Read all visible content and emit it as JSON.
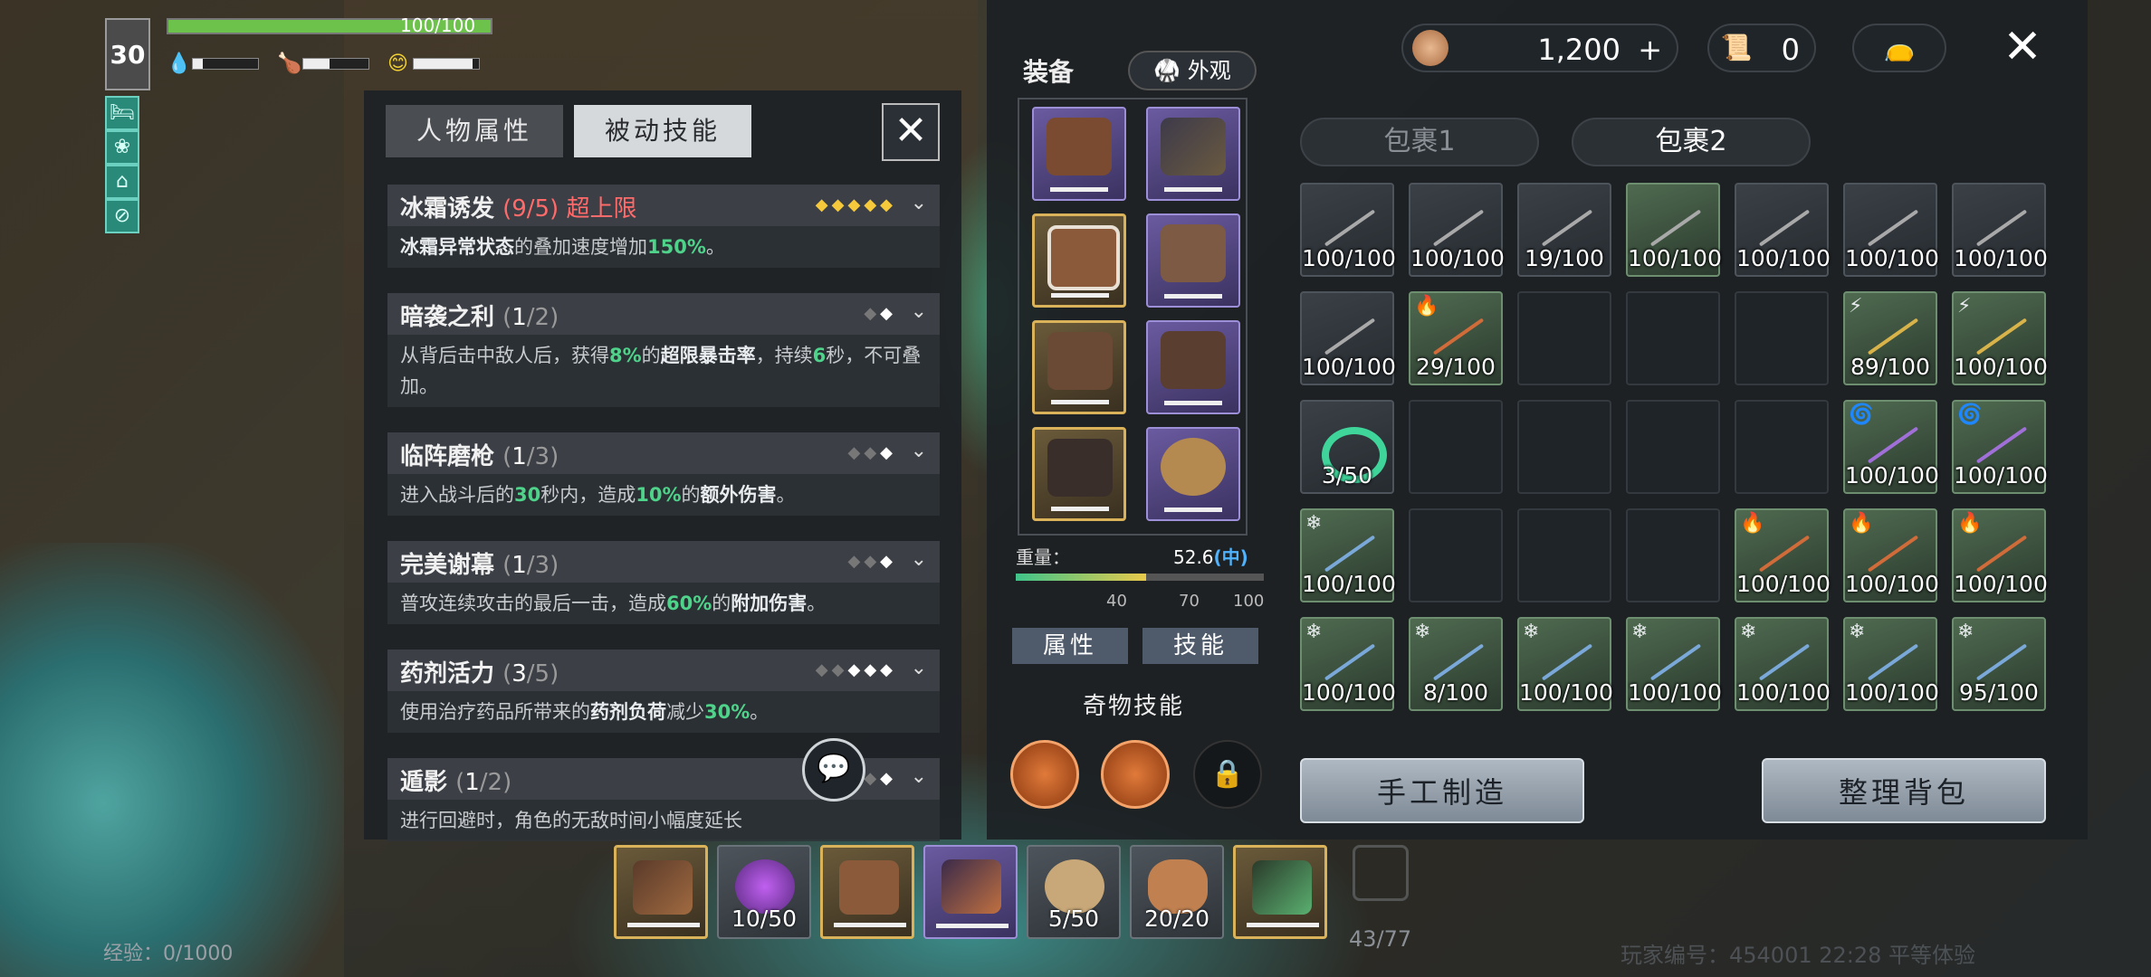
{
  "hud": {
    "level": "30",
    "hp_text": "100/100",
    "hp_fraction": 1.0,
    "water_fraction": 0.15,
    "food_fraction": 0.4,
    "mood_fraction": 0.9,
    "buff_icons": [
      "bed-icon",
      "stamina-icon",
      "house-icon",
      "no-bow-icon"
    ],
    "experience": "经验：0/1000"
  },
  "skills_panel": {
    "tabs": [
      "人物属性",
      "被动技能"
    ],
    "active_tab": 1,
    "skills": [
      {
        "name": "冰霜诱发",
        "level": "(9/5)",
        "extra": "超上限",
        "max": true,
        "desc_parts": [
          [
            "b",
            "冰霜异常状态"
          ],
          [
            "t",
            "的叠加速度增加"
          ],
          [
            "e",
            "150%"
          ],
          [
            "t",
            "。"
          ]
        ]
      },
      {
        "name": "暗袭之利",
        "level_cur": "1",
        "level_max": "/2",
        "desc_parts": [
          [
            "t",
            "从背后击中敌人后，获得"
          ],
          [
            "e",
            "8%"
          ],
          [
            "t",
            "的"
          ],
          [
            "b",
            "超限暴击率"
          ],
          [
            "t",
            "，持续"
          ],
          [
            "e",
            "6"
          ],
          [
            "t",
            "秒，不可叠加。"
          ]
        ]
      },
      {
        "name": "临阵磨枪",
        "level_cur": "1",
        "level_max": "/3",
        "desc_parts": [
          [
            "t",
            "进入战斗后的"
          ],
          [
            "e",
            "30"
          ],
          [
            "t",
            "秒内，造成"
          ],
          [
            "e",
            "10%"
          ],
          [
            "t",
            "的"
          ],
          [
            "b",
            "额外伤害"
          ],
          [
            "t",
            "。"
          ]
        ]
      },
      {
        "name": "完美谢幕",
        "level_cur": "1",
        "level_max": "/3",
        "desc_parts": [
          [
            "t",
            "普攻连续攻击的最后一击，造成"
          ],
          [
            "e",
            "60%"
          ],
          [
            "t",
            "的"
          ],
          [
            "b",
            "附加伤害"
          ],
          [
            "t",
            "。"
          ]
        ]
      },
      {
        "name": "药剂活力",
        "level_cur": "3",
        "level_max": "/5",
        "desc_parts": [
          [
            "t",
            "使用治疗药品所带来的"
          ],
          [
            "b",
            "药剂负荷"
          ],
          [
            "t",
            "减少"
          ],
          [
            "e",
            "30%"
          ],
          [
            "t",
            "。"
          ]
        ]
      },
      {
        "name": "遁影",
        "level_cur": "1",
        "level_max": "/2",
        "desc_parts": [
          [
            "t",
            "进行回避时，角色的无敌时间小幅度延长"
          ]
        ]
      }
    ]
  },
  "equipment": {
    "title": "装备",
    "appearance_label": "外观",
    "weight_label": "重量：",
    "weight_value": "52.6",
    "weight_class": "(中)",
    "weight_ticks": [
      "40",
      "70",
      "100"
    ],
    "attr_button": "属性",
    "skill_button": "技能",
    "oddity_title": "奇物技能"
  },
  "currency": {
    "coins": "1,200",
    "plus": "+",
    "scrolls": "0"
  },
  "bag": {
    "tabs": [
      "包裹1",
      "包裹2"
    ],
    "active_tab": 1,
    "rows": [
      [
        {
          "c": "100/100",
          "t": "spear",
          "g": 0
        },
        {
          "c": "100/100",
          "t": "spear",
          "g": 0
        },
        {
          "c": "19/100",
          "t": "spear",
          "g": 0
        },
        {
          "c": "100/100",
          "t": "spear",
          "g": 1
        },
        {
          "c": "100/100",
          "t": "spear",
          "g": 0
        },
        {
          "c": "100/100",
          "t": "spear",
          "g": 0
        },
        {
          "c": "100/100",
          "t": "spear",
          "g": 0
        }
      ],
      [
        {
          "c": "100/100",
          "t": "spear",
          "g": 0
        },
        {
          "c": "29/100",
          "t": "red",
          "g": 1,
          "b": "🔥"
        },
        {
          "c": "",
          "t": "empty"
        },
        {
          "c": "",
          "t": "empty"
        },
        {
          "c": "",
          "t": "empty"
        },
        {
          "c": "89/100",
          "t": "gold",
          "g": 1,
          "b": "⚡"
        },
        {
          "c": "100/100",
          "t": "gold",
          "g": 1,
          "b": "⚡"
        }
      ],
      [
        {
          "c": "3/50",
          "t": "ring",
          "g": 0
        },
        {
          "c": "",
          "t": "empty"
        },
        {
          "c": "",
          "t": "empty"
        },
        {
          "c": "",
          "t": "empty"
        },
        {
          "c": "",
          "t": "empty"
        },
        {
          "c": "100/100",
          "t": "purple",
          "g": 1,
          "b": "🌀"
        },
        {
          "c": "100/100",
          "t": "purple",
          "g": 1,
          "b": "🌀"
        }
      ],
      [
        {
          "c": "100/100",
          "t": "blue",
          "g": 1,
          "b": "❄"
        },
        {
          "c": "",
          "t": "empty"
        },
        {
          "c": "",
          "t": "empty"
        },
        {
          "c": "",
          "t": "empty"
        },
        {
          "c": "100/100",
          "t": "red",
          "g": 1,
          "b": "🔥"
        },
        {
          "c": "100/100",
          "t": "red",
          "g": 1,
          "b": "🔥"
        },
        {
          "c": "100/100",
          "t": "red",
          "g": 1,
          "b": "🔥"
        }
      ],
      [
        {
          "c": "100/100",
          "t": "blue",
          "g": 1,
          "b": "❄"
        },
        {
          "c": "8/100",
          "t": "blue",
          "g": 1,
          "b": "❄"
        },
        {
          "c": "100/100",
          "t": "blue",
          "g": 1,
          "b": "❄"
        },
        {
          "c": "100/100",
          "t": "blue",
          "g": 1,
          "b": "❄"
        },
        {
          "c": "100/100",
          "t": "blue",
          "g": 1,
          "b": "❄"
        },
        {
          "c": "100/100",
          "t": "blue",
          "g": 1,
          "b": "❄"
        },
        {
          "c": "95/100",
          "t": "blue",
          "g": 1,
          "b": "❄"
        }
      ]
    ],
    "craft_button": "手工制造",
    "sort_button": "整理背包"
  },
  "hotbar": {
    "slots": [
      "",
      "10/50",
      "",
      "",
      "5/50",
      "20/20",
      ""
    ],
    "slot_count": "43/77"
  },
  "footer": "玩家编号：454001  22:28  平等体验"
}
